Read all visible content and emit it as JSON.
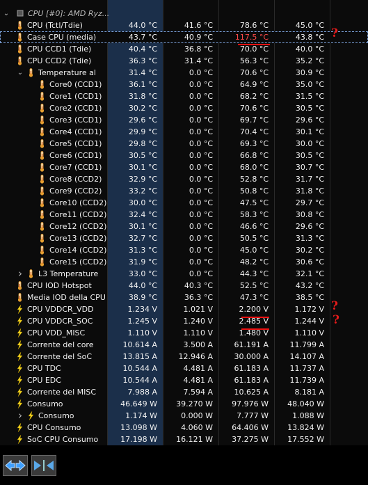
{
  "group_header": "CPU [#0]: AMD Ryz...",
  "rows": [
    {
      "name": "CPU (Tctl/Tdie)",
      "icon": "thermometer",
      "v": [
        "44.0 °C",
        "41.6 °C",
        "78.6 °C",
        "45.0 °C"
      ],
      "indent": 0
    },
    {
      "name": "Case CPU (media)",
      "icon": "thermometer",
      "v": [
        "43.7 °C",
        "40.9 °C",
        "117.5 °C",
        "43.8 °C"
      ],
      "indent": 0,
      "selected": true,
      "red": 2
    },
    {
      "name": "CPU CCD1 (Tdie)",
      "icon": "thermometer",
      "v": [
        "40.4 °C",
        "36.8 °C",
        "70.0 °C",
        "40.0 °C"
      ],
      "indent": 0
    },
    {
      "name": "CPU CCD2 (Tdie)",
      "icon": "thermometer",
      "v": [
        "36.3 °C",
        "31.4 °C",
        "56.3 °C",
        "35.2 °C"
      ],
      "indent": 0
    },
    {
      "name": "Temperature al c...",
      "icon": "thermometer",
      "v": [
        "31.4 °C",
        "0.0 °C",
        "70.6 °C",
        "30.9 °C"
      ],
      "indent": 1,
      "expand": "open"
    },
    {
      "name": "Core0 (CCD1)",
      "icon": "thermometer",
      "v": [
        "36.1 °C",
        "0.0 °C",
        "64.9 °C",
        "35.0 °C"
      ],
      "indent": 2
    },
    {
      "name": "Core1 (CCD1)",
      "icon": "thermometer",
      "v": [
        "31.8 °C",
        "0.0 °C",
        "68.2 °C",
        "31.5 °C"
      ],
      "indent": 2
    },
    {
      "name": "Core2 (CCD1)",
      "icon": "thermometer",
      "v": [
        "30.2 °C",
        "0.0 °C",
        "70.6 °C",
        "30.5 °C"
      ],
      "indent": 2
    },
    {
      "name": "Core3 (CCD1)",
      "icon": "thermometer",
      "v": [
        "29.6 °C",
        "0.0 °C",
        "69.7 °C",
        "29.6 °C"
      ],
      "indent": 2
    },
    {
      "name": "Core4 (CCD1)",
      "icon": "thermometer",
      "v": [
        "29.9 °C",
        "0.0 °C",
        "70.4 °C",
        "30.1 °C"
      ],
      "indent": 2
    },
    {
      "name": "Core5 (CCD1)",
      "icon": "thermometer",
      "v": [
        "29.8 °C",
        "0.0 °C",
        "69.3 °C",
        "30.0 °C"
      ],
      "indent": 2
    },
    {
      "name": "Core6 (CCD1)",
      "icon": "thermometer",
      "v": [
        "30.5 °C",
        "0.0 °C",
        "66.8 °C",
        "30.5 °C"
      ],
      "indent": 2
    },
    {
      "name": "Core7 (CCD1)",
      "icon": "thermometer",
      "v": [
        "30.1 °C",
        "0.0 °C",
        "68.0 °C",
        "30.7 °C"
      ],
      "indent": 2
    },
    {
      "name": "Core8 (CCD2)",
      "icon": "thermometer",
      "v": [
        "32.9 °C",
        "0.0 °C",
        "52.8 °C",
        "31.7 °C"
      ],
      "indent": 2
    },
    {
      "name": "Core9 (CCD2)",
      "icon": "thermometer",
      "v": [
        "33.2 °C",
        "0.0 °C",
        "50.8 °C",
        "31.8 °C"
      ],
      "indent": 2
    },
    {
      "name": "Core10 (CCD2)",
      "icon": "thermometer",
      "v": [
        "30.0 °C",
        "0.0 °C",
        "47.5 °C",
        "29.7 °C"
      ],
      "indent": 2
    },
    {
      "name": "Core11 (CCD2)",
      "icon": "thermometer",
      "v": [
        "32.4 °C",
        "0.0 °C",
        "58.3 °C",
        "30.8 °C"
      ],
      "indent": 2
    },
    {
      "name": "Core12 (CCD2)",
      "icon": "thermometer",
      "v": [
        "30.1 °C",
        "0.0 °C",
        "46.6 °C",
        "29.6 °C"
      ],
      "indent": 2
    },
    {
      "name": "Core13 (CCD2)",
      "icon": "thermometer",
      "v": [
        "32.7 °C",
        "0.0 °C",
        "50.5 °C",
        "31.3 °C"
      ],
      "indent": 2
    },
    {
      "name": "Core14 (CCD2)",
      "icon": "thermometer",
      "v": [
        "31.3 °C",
        "0.0 °C",
        "45.0 °C",
        "30.2 °C"
      ],
      "indent": 2
    },
    {
      "name": "Core15 (CCD2)",
      "icon": "thermometer",
      "v": [
        "31.9 °C",
        "0.0 °C",
        "48.2 °C",
        "30.6 °C"
      ],
      "indent": 2
    },
    {
      "name": "L3 Temperature",
      "icon": "thermometer",
      "v": [
        "33.0 °C",
        "0.0 °C",
        "44.3 °C",
        "32.1 °C"
      ],
      "indent": 1,
      "expand": "closed"
    },
    {
      "name": "CPU IOD Hotspot",
      "icon": "thermometer",
      "v": [
        "44.0 °C",
        "40.3 °C",
        "52.5 °C",
        "43.2 °C"
      ],
      "indent": 0
    },
    {
      "name": "Media IOD della CPU",
      "icon": "thermometer",
      "v": [
        "38.9 °C",
        "36.3 °C",
        "47.3 °C",
        "38.5 °C"
      ],
      "indent": 0
    },
    {
      "name": "CPU VDDCR_VDD Vo...",
      "icon": "bolt",
      "v": [
        "1.234 V",
        "1.021 V",
        "2.200 V",
        "1.172 V"
      ],
      "indent": 0,
      "mark": 2
    },
    {
      "name": "CPU VDDCR_SOC Vo...",
      "icon": "bolt",
      "v": [
        "1.245 V",
        "1.240 V",
        "2.485 V",
        "1.244 V"
      ],
      "indent": 0,
      "mark": 2
    },
    {
      "name": "CPU VDD_MISC Volt...",
      "icon": "bolt",
      "v": [
        "1.110 V",
        "1.110 V",
        "1.480 V",
        "1.110 V"
      ],
      "indent": 0
    },
    {
      "name": "Corrente del core de...",
      "icon": "bolt",
      "v": [
        "10.614 A",
        "3.500 A",
        "61.191 A",
        "11.799 A"
      ],
      "indent": 0
    },
    {
      "name": "Corrente del SoC (S...",
      "icon": "bolt",
      "v": [
        "13.815 A",
        "12.946 A",
        "30.000 A",
        "14.107 A"
      ],
      "indent": 0
    },
    {
      "name": "CPU TDC",
      "icon": "bolt",
      "v": [
        "10.544 A",
        "4.481 A",
        "61.183 A",
        "11.737 A"
      ],
      "indent": 0
    },
    {
      "name": "CPU EDC",
      "icon": "bolt",
      "v": [
        "10.544 A",
        "4.481 A",
        "61.183 A",
        "11.739 A"
      ],
      "indent": 0
    },
    {
      "name": "Corrente del MISC (...",
      "icon": "bolt",
      "v": [
        "7.988 A",
        "7.594 A",
        "10.625 A",
        "8.181 A"
      ],
      "indent": 0
    },
    {
      "name": "Consumo energetico...",
      "icon": "bolt",
      "v": [
        "46.649 W",
        "39.270 W",
        "97.976 W",
        "48.040 W"
      ],
      "indent": 0
    },
    {
      "name": "Consumo energe...",
      "icon": "bolt",
      "v": [
        "1.174 W",
        "0.000 W",
        "7.777 W",
        "1.088 W"
      ],
      "indent": 1,
      "expand": "closed"
    },
    {
      "name": "CPU Consumo energ...",
      "icon": "bolt",
      "v": [
        "13.098 W",
        "4.060 W",
        "64.406 W",
        "13.824 W"
      ],
      "indent": 0
    },
    {
      "name": "SoC CPU Consumo e...",
      "icon": "bolt",
      "v": [
        "17.198 W",
        "16.121 W",
        "37.275 W",
        "17.552 W"
      ],
      "indent": 0
    }
  ],
  "annotations": {
    "question_mark": "?"
  },
  "colors": {
    "accent_column": "#1b2f4a",
    "red_value": "#ff4a4a",
    "annotation": "#e41b1b",
    "temp_icon": "#e8a030",
    "bolt_icon": "#f2d21e"
  }
}
